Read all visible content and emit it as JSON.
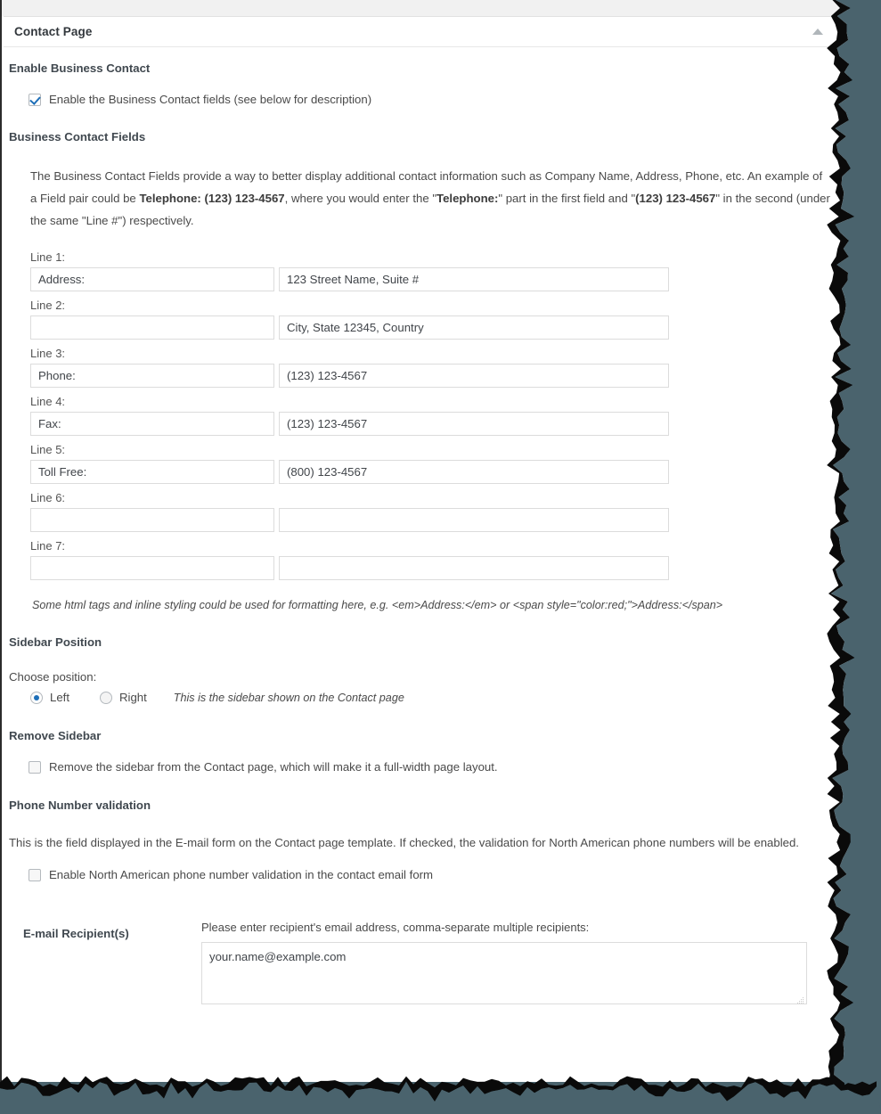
{
  "metabox": {
    "title": "Contact Page",
    "toggle_icon": "triangle-up-icon"
  },
  "sections": {
    "enable_business_contact": {
      "heading": "Enable Business Contact",
      "checkbox_label": "Enable the Business Contact fields (see below for description)",
      "checked": true
    },
    "business_contact_fields": {
      "heading": "Business Contact Fields",
      "description_part1": "The Business Contact Fields provide a way to better display additional contact information such as Company Name, Address, Phone, etc. An example of a Field pair could be ",
      "description_bold1": "Telephone: (123) 123-4567",
      "description_part2": ", where you would enter the \"",
      "description_bold2": "Telephone:",
      "description_part3": "\" part in the first field and \"",
      "description_bold3": "(123) 123-4567",
      "description_part4": "\" in the second (under the same \"Line #\") respectively.",
      "lines": [
        {
          "label": "Line 1:",
          "left_value": "Address:",
          "right_value": "123 Street Name, Suite #"
        },
        {
          "label": "Line 2:",
          "left_value": "",
          "right_value": "City, State 12345, Country"
        },
        {
          "label": "Line 3:",
          "left_value": "Phone:",
          "right_value": "(123) 123-4567"
        },
        {
          "label": "Line 4:",
          "left_value": "Fax:",
          "right_value": "(123) 123-4567"
        },
        {
          "label": "Line 5:",
          "left_value": "Toll Free:",
          "right_value": "(800) 123-4567"
        },
        {
          "label": "Line 6:",
          "left_value": "",
          "right_value": ""
        },
        {
          "label": "Line 7:",
          "left_value": "",
          "right_value": ""
        }
      ],
      "html_hint": "Some html tags and inline styling could be used for formatting here, e.g. <em>Address:</em> or <span style=\"color:red;\">Address:</span>"
    },
    "sidebar_position": {
      "heading": "Sidebar Position",
      "choose_label": "Choose position:",
      "option_left": "Left",
      "option_right": "Right",
      "selected": "Left",
      "note": "This is the sidebar shown on the Contact page"
    },
    "remove_sidebar": {
      "heading": "Remove Sidebar",
      "checkbox_label": "Remove the sidebar from the Contact page, which will make it a full-width page layout.",
      "checked": false
    },
    "phone_validation": {
      "heading": "Phone Number validation",
      "description": "This is the field displayed in the E-mail form on the Contact page template. If checked, the validation for North American phone numbers will be enabled.",
      "checkbox_label": "Enable North American phone number validation in the contact email form",
      "checked": false
    },
    "email_recipients": {
      "label": "E-mail Recipient(s)",
      "hint": "Please enter recipient's email address, comma-separate multiple recipients:",
      "value": "your.name@example.com"
    }
  },
  "colors": {
    "page_background": "#4a636d",
    "paper": "#ffffff",
    "heading": "#40484f",
    "accent": "#1e6fb8",
    "border": "#dcdcdc"
  }
}
